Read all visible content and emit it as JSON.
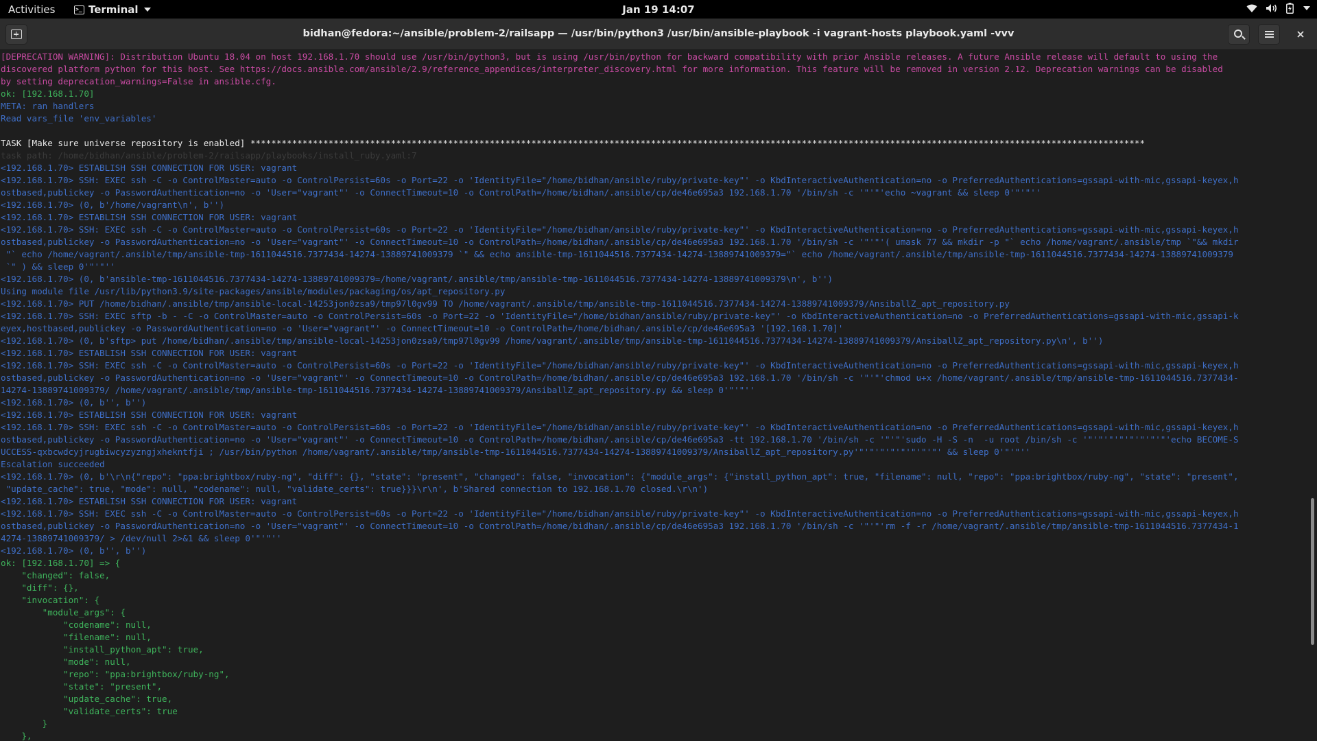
{
  "topbar": {
    "activities": "Activities",
    "app_name": "Terminal",
    "clock": "Jan 19  14:07",
    "tray_icons": [
      "wifi-icon",
      "volume-icon",
      "battery-icon",
      "system-menu-caret-icon"
    ]
  },
  "window": {
    "title": "bidhan@fedora:~/ansible/problem-2/railsapp — /usr/bin/python3 /usr/bin/ansible-playbook -i vagrant-hosts playbook.yaml -vvv",
    "buttons": [
      "new-tab-icon",
      "search-icon",
      "hamburger-menu-icon",
      "close-icon"
    ]
  },
  "terminal": {
    "lines": [
      {
        "t": "[DEPRECATION WARNING]: Distribution Ubuntu 18.04 on host 192.168.1.70 should use /usr/bin/python3, but is using /usr/bin/python for backward compatibility with prior Ansible releases. A future Ansible release will default to using the",
        "c": "magenta"
      },
      {
        "t": "discovered platform python for this host. See https://docs.ansible.com/ansible/2.9/reference_appendices/interpreter_discovery.html for more information. This feature will be removed in version 2.12. Deprecation warnings can be disabled",
        "c": "magenta"
      },
      {
        "t": "by setting deprecation_warnings=False in ansible.cfg.",
        "c": "magenta"
      },
      {
        "t": "ok: [192.168.1.70]",
        "c": "green"
      },
      {
        "t": "META: ran handlers",
        "c": "blue"
      },
      {
        "t": "Read vars_file 'env_variables'",
        "c": "blue"
      },
      {
        "t": "",
        "c": "white"
      },
      {
        "t": "TASK [Make sure universe repository is enabled] ****************************************************************************************************************************************************************************",
        "c": "white"
      },
      {
        "t": "task path: /home/bidhan/ansible/problem-2/railsapp/playbooks/install_ruby.yaml:7",
        "c": "dim"
      },
      {
        "t": "<192.168.1.70> ESTABLISH SSH CONNECTION FOR USER: vagrant",
        "c": "blue"
      },
      {
        "t": "<192.168.1.70> SSH: EXEC ssh -C -o ControlMaster=auto -o ControlPersist=60s -o Port=22 -o 'IdentityFile=\"/home/bidhan/ansible/ruby/private-key\"' -o KbdInteractiveAuthentication=no -o PreferredAuthentications=gssapi-with-mic,gssapi-keyex,h",
        "c": "blue"
      },
      {
        "t": "ostbased,publickey -o PasswordAuthentication=no -o 'User=\"vagrant\"' -o ConnectTimeout=10 -o ControlPath=/home/bidhan/.ansible/cp/de46e695a3 192.168.1.70 '/bin/sh -c '\"'\"'echo ~vagrant && sleep 0'\"'\"''",
        "c": "blue"
      },
      {
        "t": "<192.168.1.70> (0, b'/home/vagrant\\n', b'')",
        "c": "blue"
      },
      {
        "t": "<192.168.1.70> ESTABLISH SSH CONNECTION FOR USER: vagrant",
        "c": "blue"
      },
      {
        "t": "<192.168.1.70> SSH: EXEC ssh -C -o ControlMaster=auto -o ControlPersist=60s -o Port=22 -o 'IdentityFile=\"/home/bidhan/ansible/ruby/private-key\"' -o KbdInteractiveAuthentication=no -o PreferredAuthentications=gssapi-with-mic,gssapi-keyex,h",
        "c": "blue"
      },
      {
        "t": "ostbased,publickey -o PasswordAuthentication=no -o 'User=\"vagrant\"' -o ConnectTimeout=10 -o ControlPath=/home/bidhan/.ansible/cp/de46e695a3 192.168.1.70 '/bin/sh -c '\"'\"'( umask 77 && mkdir -p \"` echo /home/vagrant/.ansible/tmp `\"&& mkdir",
        "c": "blue"
      },
      {
        "t": " \"` echo /home/vagrant/.ansible/tmp/ansible-tmp-1611044516.7377434-14274-13889741009379 `\" && echo ansible-tmp-1611044516.7377434-14274-13889741009379=\"` echo /home/vagrant/.ansible/tmp/ansible-tmp-1611044516.7377434-14274-13889741009379",
        "c": "blue"
      },
      {
        "t": " `\" ) && sleep 0'\"'\"''",
        "c": "blue"
      },
      {
        "t": "<192.168.1.70> (0, b'ansible-tmp-1611044516.7377434-14274-13889741009379=/home/vagrant/.ansible/tmp/ansible-tmp-1611044516.7377434-14274-13889741009379\\n', b'')",
        "c": "blue"
      },
      {
        "t": "Using module file /usr/lib/python3.9/site-packages/ansible/modules/packaging/os/apt_repository.py",
        "c": "blue"
      },
      {
        "t": "<192.168.1.70> PUT /home/bidhan/.ansible/tmp/ansible-local-14253jon0zsa9/tmp97l0gv99 TO /home/vagrant/.ansible/tmp/ansible-tmp-1611044516.7377434-14274-13889741009379/AnsiballZ_apt_repository.py",
        "c": "blue"
      },
      {
        "t": "<192.168.1.70> SSH: EXEC sftp -b - -C -o ControlMaster=auto -o ControlPersist=60s -o Port=22 -o 'IdentityFile=\"/home/bidhan/ansible/ruby/private-key\"' -o KbdInteractiveAuthentication=no -o PreferredAuthentications=gssapi-with-mic,gssapi-k",
        "c": "blue"
      },
      {
        "t": "eyex,hostbased,publickey -o PasswordAuthentication=no -o 'User=\"vagrant\"' -o ConnectTimeout=10 -o ControlPath=/home/bidhan/.ansible/cp/de46e695a3 '[192.168.1.70]'",
        "c": "blue"
      },
      {
        "t": "<192.168.1.70> (0, b'sftp> put /home/bidhan/.ansible/tmp/ansible-local-14253jon0zsa9/tmp97l0gv99 /home/vagrant/.ansible/tmp/ansible-tmp-1611044516.7377434-14274-13889741009379/AnsiballZ_apt_repository.py\\n', b'')",
        "c": "blue"
      },
      {
        "t": "<192.168.1.70> ESTABLISH SSH CONNECTION FOR USER: vagrant",
        "c": "blue"
      },
      {
        "t": "<192.168.1.70> SSH: EXEC ssh -C -o ControlMaster=auto -o ControlPersist=60s -o Port=22 -o 'IdentityFile=\"/home/bidhan/ansible/ruby/private-key\"' -o KbdInteractiveAuthentication=no -o PreferredAuthentications=gssapi-with-mic,gssapi-keyex,h",
        "c": "blue"
      },
      {
        "t": "ostbased,publickey -o PasswordAuthentication=no -o 'User=\"vagrant\"' -o ConnectTimeout=10 -o ControlPath=/home/bidhan/.ansible/cp/de46e695a3 192.168.1.70 '/bin/sh -c '\"'\"'chmod u+x /home/vagrant/.ansible/tmp/ansible-tmp-1611044516.7377434-",
        "c": "blue"
      },
      {
        "t": "14274-13889741009379/ /home/vagrant/.ansible/tmp/ansible-tmp-1611044516.7377434-14274-13889741009379/AnsiballZ_apt_repository.py && sleep 0'\"'\"''",
        "c": "blue"
      },
      {
        "t": "<192.168.1.70> (0, b'', b'')",
        "c": "blue"
      },
      {
        "t": "<192.168.1.70> ESTABLISH SSH CONNECTION FOR USER: vagrant",
        "c": "blue"
      },
      {
        "t": "<192.168.1.70> SSH: EXEC ssh -C -o ControlMaster=auto -o ControlPersist=60s -o Port=22 -o 'IdentityFile=\"/home/bidhan/ansible/ruby/private-key\"' -o KbdInteractiveAuthentication=no -o PreferredAuthentications=gssapi-with-mic,gssapi-keyex,h",
        "c": "blue"
      },
      {
        "t": "ostbased,publickey -o PasswordAuthentication=no -o 'User=\"vagrant\"' -o ConnectTimeout=10 -o ControlPath=/home/bidhan/.ansible/cp/de46e695a3 -tt 192.168.1.70 '/bin/sh -c '\"'\"'sudo -H -S -n  -u root /bin/sh -c '\"'\"'\"'\"'\"'\"'\"'\"'echo BECOME-S",
        "c": "blue"
      },
      {
        "t": "UCCESS-qxbcwdcyjrugbiwcyzyzngjxhekntfji ; /usr/bin/python /home/vagrant/.ansible/tmp/ansible-tmp-1611044516.7377434-14274-13889741009379/AnsiballZ_apt_repository.py'\"'\"'\"'\"'\"'\"'\"'\"' && sleep 0'\"'\"''",
        "c": "blue"
      },
      {
        "t": "Escalation succeeded",
        "c": "blue"
      },
      {
        "t": "<192.168.1.70> (0, b'\\r\\n{\"repo\": \"ppa:brightbox/ruby-ng\", \"diff\": {}, \"state\": \"present\", \"changed\": false, \"invocation\": {\"module_args\": {\"install_python_apt\": true, \"filename\": null, \"repo\": \"ppa:brightbox/ruby-ng\", \"state\": \"present\",",
        "c": "blue"
      },
      {
        "t": " \"update_cache\": true, \"mode\": null, \"codename\": null, \"validate_certs\": true}}}\\r\\n', b'Shared connection to 192.168.1.70 closed.\\r\\n')",
        "c": "blue"
      },
      {
        "t": "<192.168.1.70> ESTABLISH SSH CONNECTION FOR USER: vagrant",
        "c": "blue"
      },
      {
        "t": "<192.168.1.70> SSH: EXEC ssh -C -o ControlMaster=auto -o ControlPersist=60s -o Port=22 -o 'IdentityFile=\"/home/bidhan/ansible/ruby/private-key\"' -o KbdInteractiveAuthentication=no -o PreferredAuthentications=gssapi-with-mic,gssapi-keyex,h",
        "c": "blue"
      },
      {
        "t": "ostbased,publickey -o PasswordAuthentication=no -o 'User=\"vagrant\"' -o ConnectTimeout=10 -o ControlPath=/home/bidhan/.ansible/cp/de46e695a3 192.168.1.70 '/bin/sh -c '\"'\"'rm -f -r /home/vagrant/.ansible/tmp/ansible-tmp-1611044516.7377434-1",
        "c": "blue"
      },
      {
        "t": "4274-13889741009379/ > /dev/null 2>&1 && sleep 0'\"'\"''",
        "c": "blue"
      },
      {
        "t": "<192.168.1.70> (0, b'', b'')",
        "c": "blue"
      },
      {
        "t": "ok: [192.168.1.70] => {",
        "c": "green"
      },
      {
        "t": "    \"changed\": false,",
        "c": "green"
      },
      {
        "t": "    \"diff\": {},",
        "c": "green"
      },
      {
        "t": "    \"invocation\": {",
        "c": "green"
      },
      {
        "t": "        \"module_args\": {",
        "c": "green"
      },
      {
        "t": "            \"codename\": null,",
        "c": "green"
      },
      {
        "t": "            \"filename\": null,",
        "c": "green"
      },
      {
        "t": "            \"install_python_apt\": true,",
        "c": "green"
      },
      {
        "t": "            \"mode\": null,",
        "c": "green"
      },
      {
        "t": "            \"repo\": \"ppa:brightbox/ruby-ng\",",
        "c": "green"
      },
      {
        "t": "            \"state\": \"present\",",
        "c": "green"
      },
      {
        "t": "            \"update_cache\": true,",
        "c": "green"
      },
      {
        "t": "            \"validate_certs\": true",
        "c": "green"
      },
      {
        "t": "        }",
        "c": "green"
      },
      {
        "t": "    },",
        "c": "green"
      }
    ]
  },
  "colors": {
    "background": "#1e1e1e",
    "magenta": "#c94ba3",
    "green": "#3fb45c",
    "blue": "#3f6fc8",
    "white": "#eaeaea",
    "dim": "#3b3b3b"
  }
}
